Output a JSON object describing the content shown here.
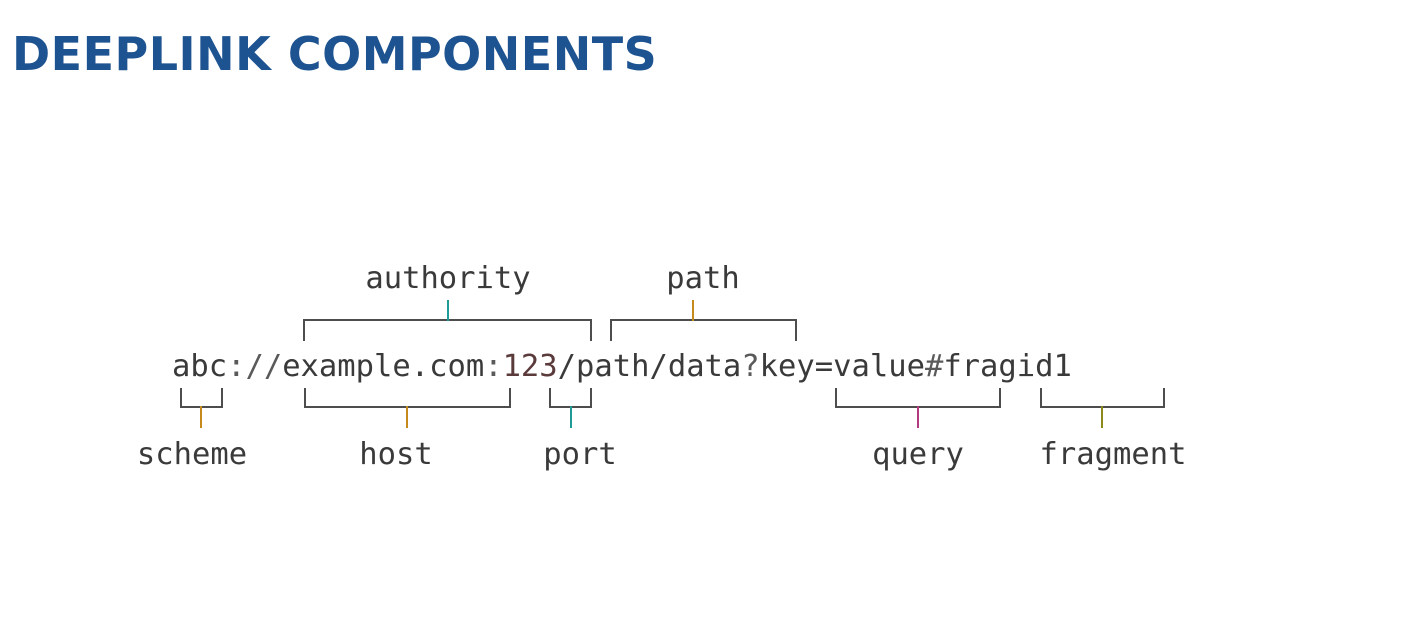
{
  "title": "DEEPLINK COMPONENTS",
  "url": {
    "scheme": "abc",
    "scheme_sep": "://",
    "host": "example.com",
    "port_sep": ":",
    "port": "123",
    "path": "/path/data",
    "query_sep": "?",
    "query": "key=value",
    "fragment_sep": "#",
    "fragment": "fragid1"
  },
  "labels": {
    "authority": "authority",
    "path": "path",
    "scheme": "scheme",
    "host": "host",
    "port": "port",
    "query": "query",
    "fragment": "fragment"
  },
  "colors": {
    "title": "#1d5390",
    "text": "#3a3a3a",
    "bracket": "#4d4d4d",
    "scheme_stem": "#c58a1b",
    "host_stem": "#c58a1b",
    "port_stem": "#1f9b95",
    "query_stem": "#b23a7f",
    "fragment_stem": "#8d8a1c",
    "authority_stem": "#1f9b95",
    "path_stem": "#c58a1b"
  }
}
